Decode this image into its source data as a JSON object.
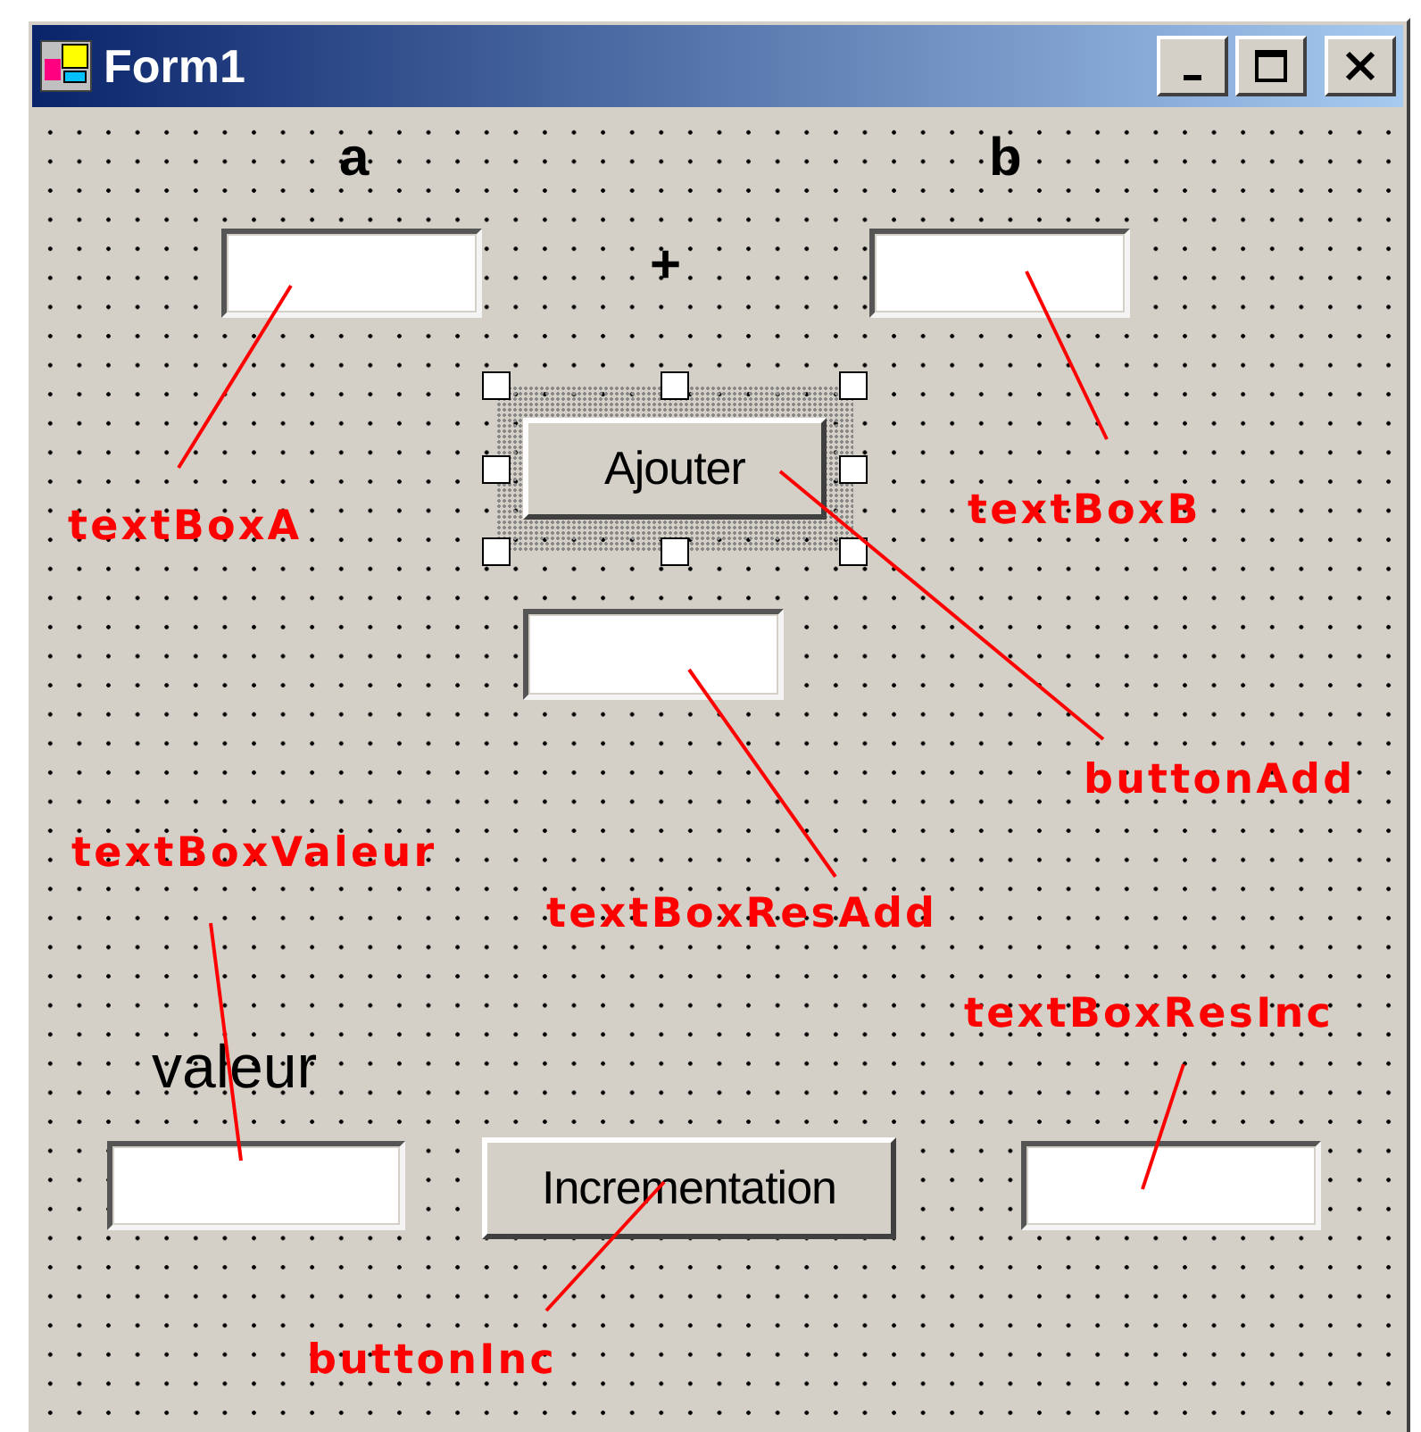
{
  "window": {
    "title": "Form1",
    "controls": [
      {
        "kind": "label",
        "text": "a"
      },
      {
        "kind": "label",
        "text": "b"
      },
      {
        "kind": "textbox"
      },
      {
        "kind": "label",
        "text": "+"
      },
      {
        "kind": "textbox"
      },
      {
        "kind": "button",
        "text": "Ajouter",
        "selected": true
      },
      {
        "kind": "textbox"
      },
      {
        "kind": "label",
        "text": "valeur"
      },
      {
        "kind": "textbox"
      },
      {
        "kind": "button",
        "text": "Incrementation",
        "selected": false
      },
      {
        "kind": "textbox"
      }
    ]
  },
  "annotations": [
    {
      "text": "textBoxA"
    },
    {
      "text": "textBoxB"
    },
    {
      "text": "buttonAdd"
    },
    {
      "text": "textBoxValeur"
    },
    {
      "text": "textBoxResAdd"
    },
    {
      "text": "textBoxResInc"
    },
    {
      "text": "buttonInc"
    }
  ]
}
